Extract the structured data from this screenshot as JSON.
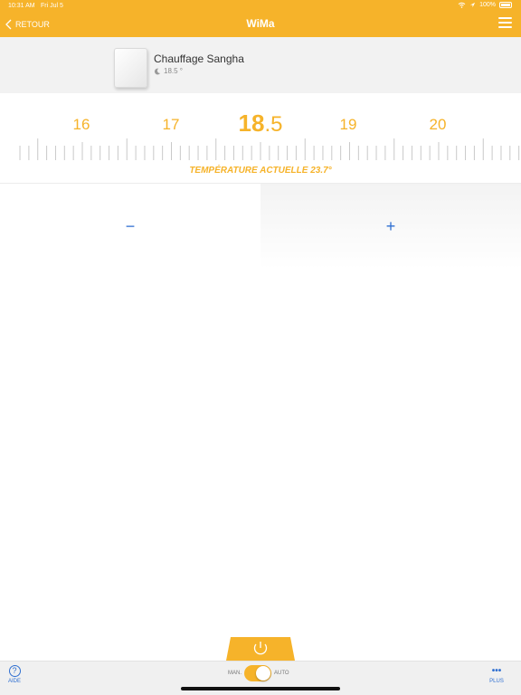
{
  "status_bar": {
    "time": "10:31 AM",
    "date": "Fri Jul 5",
    "battery": "100%"
  },
  "header": {
    "back_label": "RETOUR",
    "title": "WiMa"
  },
  "device": {
    "name": "Chauffage Sangha",
    "setpoint": "18.5 °"
  },
  "ruler": {
    "labels": [
      "16",
      "17",
      "18",
      "19",
      "20"
    ],
    "selected_whole": "18",
    "selected_decimal": ".5",
    "current_temperature": "TEMPÉRATURE ACTUELLE 23.7°"
  },
  "controls": {
    "minus": "−",
    "plus": "+"
  },
  "bottom_bar": {
    "help_label": "AIDE",
    "mode_manual": "MAN.",
    "mode_auto": "AUTO",
    "mode_state": "auto",
    "more_label": "PLUS"
  },
  "colors": {
    "accent": "#f6b32a",
    "link": "#2f6fd1"
  },
  "icons": [
    "chevron-left-icon",
    "hamburger-menu-icon",
    "moon-icon",
    "power-icon",
    "help-icon",
    "more-icon",
    "wifi-icon",
    "location-icon",
    "battery-icon"
  ]
}
